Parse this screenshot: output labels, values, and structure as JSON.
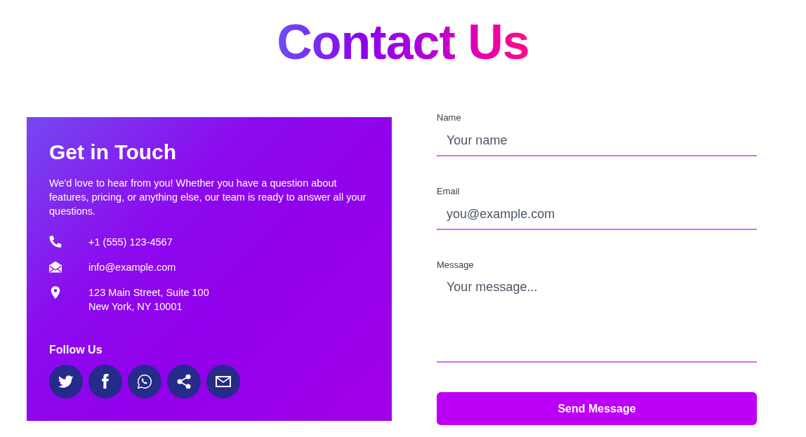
{
  "title": "Contact Us",
  "info_card": {
    "heading": "Get in Touch",
    "description": "We'd love to hear from you! Whether you have a question about features, pricing, or anything else, our team is ready to answer all your questions.",
    "contacts": [
      {
        "kind": "phone",
        "text": "+1 (555) 123-4567"
      },
      {
        "kind": "email",
        "text": "info@example.com"
      },
      {
        "kind": "address",
        "text": "123 Main Street, Suite 100\nNew York, NY 10001"
      }
    ],
    "follow_heading": "Follow Us"
  },
  "form": {
    "fields": [
      {
        "kind": "text",
        "label": "Name",
        "placeholder": "Your name"
      },
      {
        "kind": "text",
        "label": "Email",
        "placeholder": "you@example.com"
      },
      {
        "kind": "textarea",
        "label": "Message",
        "placeholder": "Your message..."
      }
    ],
    "submit": "Send Message"
  }
}
